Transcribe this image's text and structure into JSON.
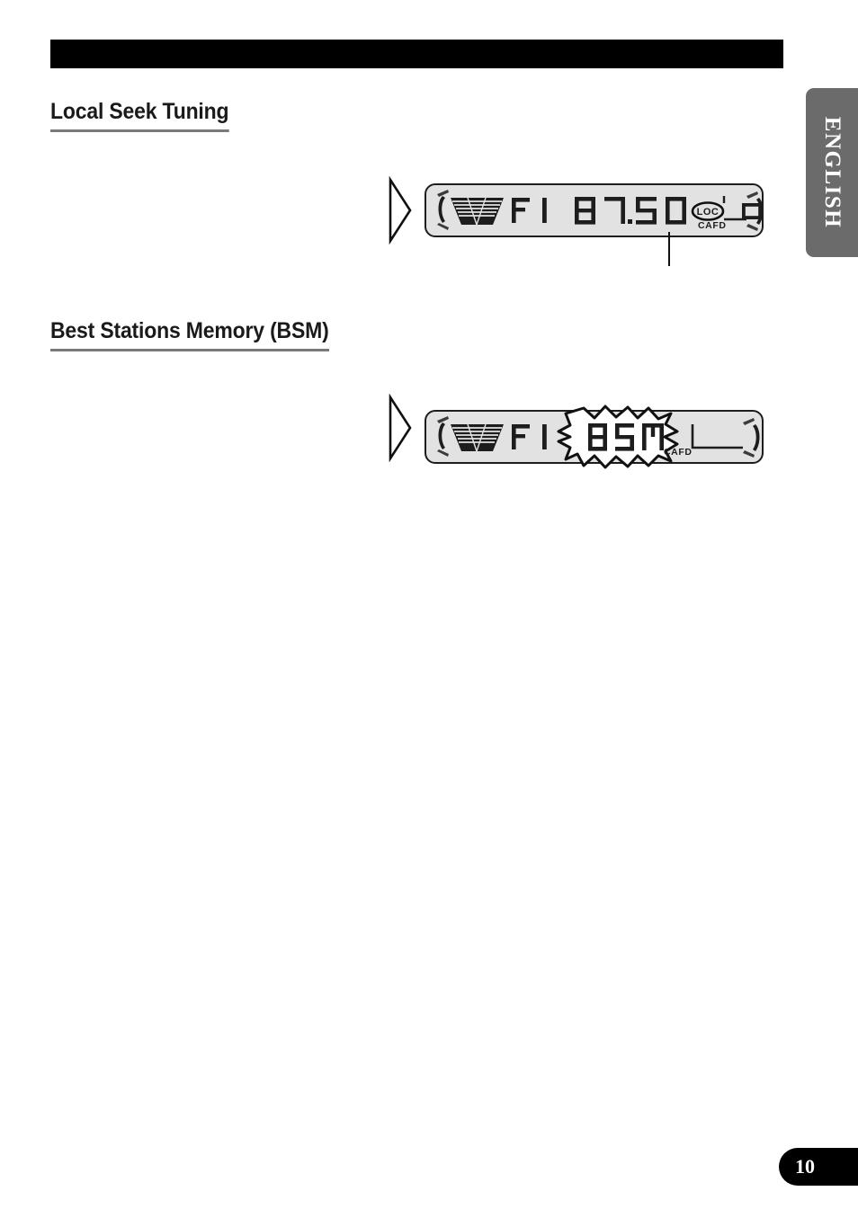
{
  "page": {
    "number": "10",
    "language_tab": "ENGLISH",
    "header_bar_color": "#000000",
    "lang_tab_color": "#6b6b6b",
    "lcd_panel_color": "#e2e2e2",
    "ink_color": "#1a1a1a"
  },
  "sections": [
    {
      "id": "local-seek-tuning",
      "title": "Local Seek Tuning",
      "display": {
        "band": "F 1",
        "frequency": "87.50",
        "indicator_loc": "LOC",
        "indicator_small": "CAFD",
        "preset_number": "0",
        "eq_icon": "loudness-icon",
        "highlight": "loc-circled",
        "callout_leader": true
      }
    },
    {
      "id": "best-stations-memory",
      "title": "Best Stations Memory (BSM)",
      "display": {
        "band": "F 1",
        "frequency": "BSM",
        "indicator_small": "CAFD",
        "preset_number": "",
        "eq_icon": "loudness-icon",
        "highlight": "bsm-flashing-starburst",
        "callout_leader": false
      }
    }
  ]
}
